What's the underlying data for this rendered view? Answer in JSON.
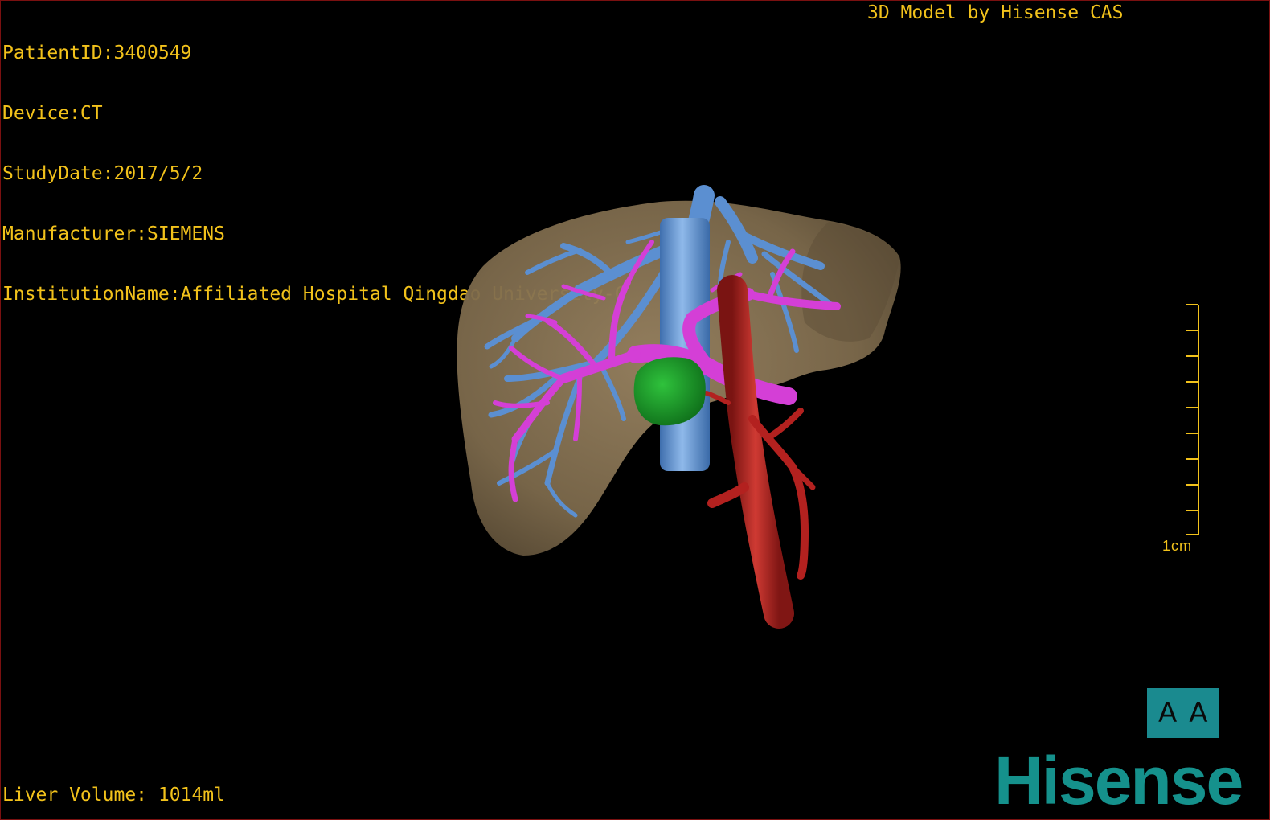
{
  "dicom_info": {
    "patient_id": "PatientID:3400549",
    "device": "Device:CT",
    "study_date": "StudyDate:2017/5/2",
    "manufacturer": "Manufacturer:SIEMENS",
    "institution": "InstitutionName:Affiliated Hospital Qingdao University-C"
  },
  "credit": "3D Model by Hisense CAS",
  "liver_volume": "Liver Volume: 1014ml",
  "scale": {
    "label": "1cm",
    "color": "#f2c21b"
  },
  "orientation": {
    "left": "A",
    "right": "A"
  },
  "brand": "Hisense",
  "colors": {
    "overlay_text": "#f2c21b",
    "liver": "#8a7656",
    "hepatic_vein": "#5b8fd1",
    "portal_vein": "#d43fd6",
    "artery": "#b3211f",
    "tumor": "#1a9a2a",
    "brand": "#15918c"
  }
}
